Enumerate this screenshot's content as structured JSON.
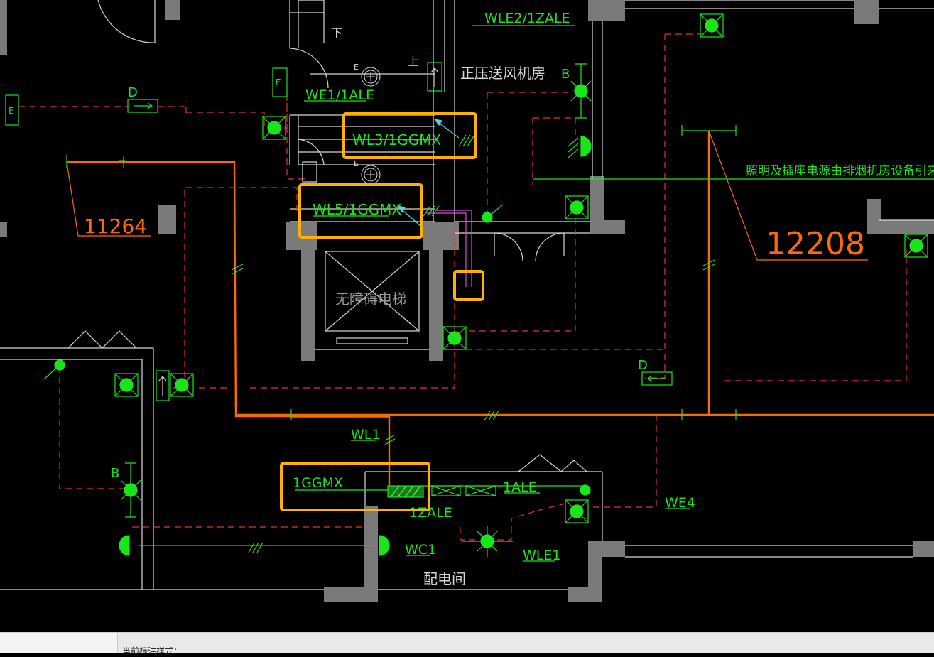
{
  "drawing": {
    "room_labels": {
      "fan_room": "正压送风机房",
      "elevator": "无障碍电梯",
      "distribution_room": "配电间",
      "stair_down": "下",
      "stair_up": "上"
    },
    "circuit_labels": {
      "wle2_1zale": "WLE2/1ZALE",
      "we1_1ale": "WE1/1ALE",
      "wl3_1ggmx": "WL3/1GGMX",
      "wl5_1ggmx": "WL5/1GGMX",
      "wl1": "WL1",
      "panel_1ggmx": "1GGMX",
      "panel_1ale": "1ALE",
      "panel_1zale": "1ZALE",
      "we4": "WE4",
      "wc1": "WC1",
      "wle1": "WLE1"
    },
    "symbol_letters": {
      "d_top": "D",
      "d_right": "D",
      "b_top": "B",
      "b_left": "B",
      "e_1": "E",
      "e_2": "E",
      "e_3": "E",
      "e_4": "E"
    },
    "dimensions": {
      "left": "11264",
      "right": "12208"
    },
    "notes": {
      "power_source": "照明及插座电源由排烟机房设备引来"
    },
    "colors": {
      "background": "#000000",
      "wall": "#7a7a7a",
      "linework": "#d8d8d8",
      "green": "#19e619",
      "red_dashed": "#e53030",
      "orange": "#ff6a00",
      "highlight": "#ffb000",
      "magenta": "#d64fd6",
      "cyan": "#4ad9e6"
    }
  },
  "status_bar": {
    "text": "当前标注样式：..."
  }
}
